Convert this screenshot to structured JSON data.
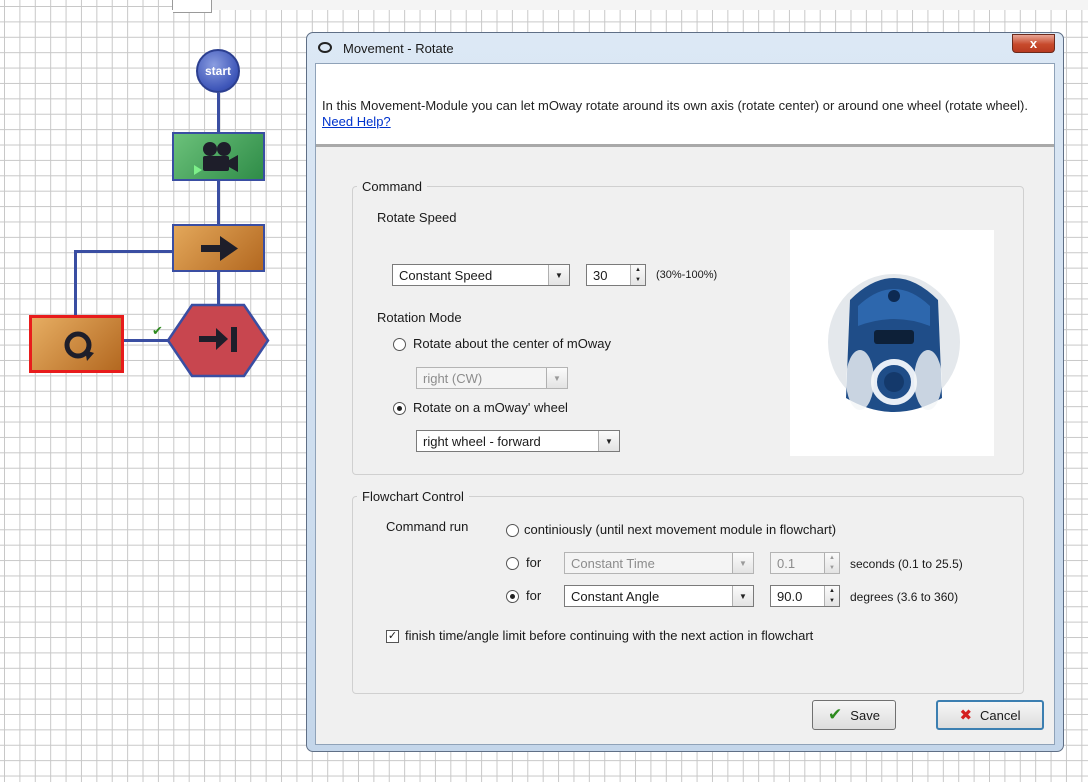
{
  "flowchart": {
    "start_label": "start"
  },
  "dialog": {
    "title": "Movement - Rotate",
    "close_label": "x",
    "intro_text": "In this Movement-Module you can let mOway rotate around its own axis (rotate center) or around one wheel (rotate wheel).",
    "help_link": "Need Help?"
  },
  "command": {
    "legend": "Command",
    "rotate_speed_label": "Rotate Speed",
    "speed_mode": "Constant Speed",
    "speed_value": "30",
    "speed_range": "(30%-100%)",
    "rotation_mode_label": "Rotation Mode",
    "center_option": "Rotate about the center of mOway",
    "center_direction": "right (CW)",
    "wheel_option": "Rotate on a mOway' wheel",
    "wheel_direction": "right wheel - forward"
  },
  "flow": {
    "legend": "Flowchart Control",
    "command_run_label": "Command run",
    "continuously_option": "continiously (until next movement module in flowchart)",
    "for_label": "for",
    "time_mode": "Constant Time",
    "time_value": "0.1",
    "time_unit": "seconds (0.1 to 25.5)",
    "angle_mode": "Constant Angle",
    "angle_value": "90.0",
    "angle_unit": "degrees (3.6 to 360)",
    "finish_checkbox": "finish time/angle limit before continuing with the next action in flowchart"
  },
  "buttons": {
    "save": "Save",
    "cancel": "Cancel"
  },
  "colors": {
    "link": "#0033cc",
    "close_button": "#c74a2c",
    "save_icon": "#2d8a1e",
    "cancel_icon": "#d42020",
    "selected_block_border": "#e81c1c"
  }
}
